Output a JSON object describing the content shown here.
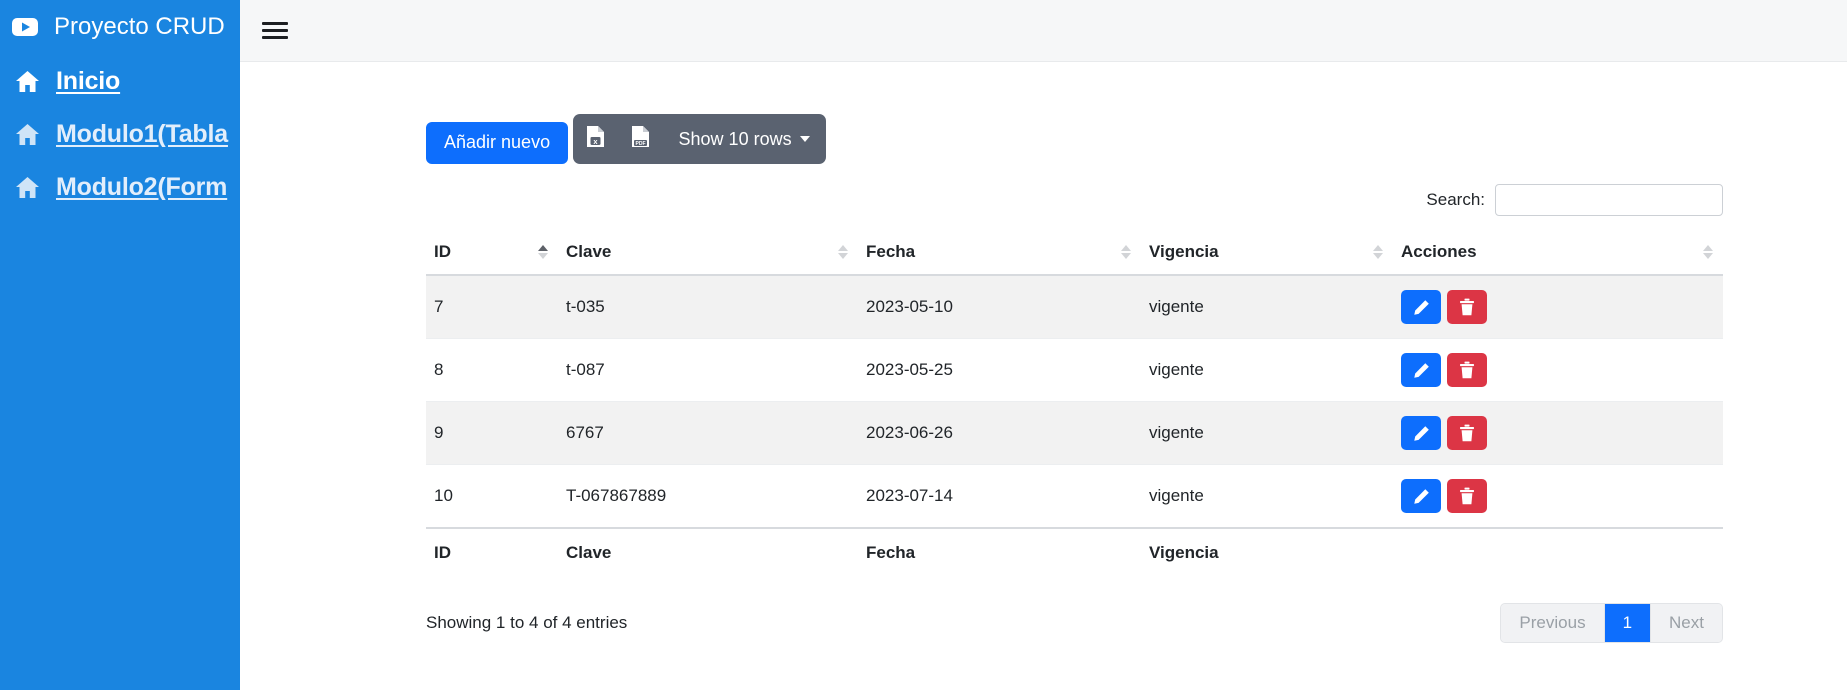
{
  "sidebar": {
    "brand": {
      "icon": "youtube-icon",
      "title": "Proyecto CRUD"
    },
    "items": [
      {
        "icon": "home-icon",
        "label": "Inicio"
      },
      {
        "icon": "home-icon",
        "label": "Modulo1(Tabla"
      },
      {
        "icon": "home-icon",
        "label": "Modulo2(Form"
      }
    ]
  },
  "topbar": {
    "menu_icon": "hamburger-icon"
  },
  "toolbar": {
    "add_label": "Añadir nuevo",
    "excel_icon": "excel-file-icon",
    "pdf_icon": "pdf-file-icon",
    "length_label": "Show 10 rows"
  },
  "search": {
    "label": "Search:",
    "value": "",
    "placeholder": ""
  },
  "table": {
    "columns": [
      "ID",
      "Clave",
      "Fecha",
      "Vigencia",
      "Acciones"
    ],
    "footer_columns": [
      "ID",
      "Clave",
      "Fecha",
      "Vigencia",
      ""
    ],
    "rows": [
      {
        "id": "7",
        "clave": "t-035",
        "fecha": "2023-05-10",
        "vigencia": "vigente"
      },
      {
        "id": "8",
        "clave": "t-087",
        "fecha": "2023-05-25",
        "vigencia": "vigente"
      },
      {
        "id": "9",
        "clave": "6767",
        "fecha": "2023-06-26",
        "vigencia": "vigente"
      },
      {
        "id": "10",
        "clave": "T-067867889",
        "fecha": "2023-07-14",
        "vigencia": "vigente"
      }
    ],
    "row_actions": {
      "edit_icon": "pencil-icon",
      "delete_icon": "trash-icon"
    }
  },
  "footer": {
    "showing": "Showing 1 to 4 of 4 entries",
    "pagination": {
      "previous": "Previous",
      "pages": [
        "1"
      ],
      "next": "Next",
      "current": "1"
    }
  },
  "colors": {
    "sidebar_bg": "#1a85e0",
    "primary": "#0d6efd",
    "danger": "#dc3545",
    "dt_button_bg": "#5a6270"
  }
}
